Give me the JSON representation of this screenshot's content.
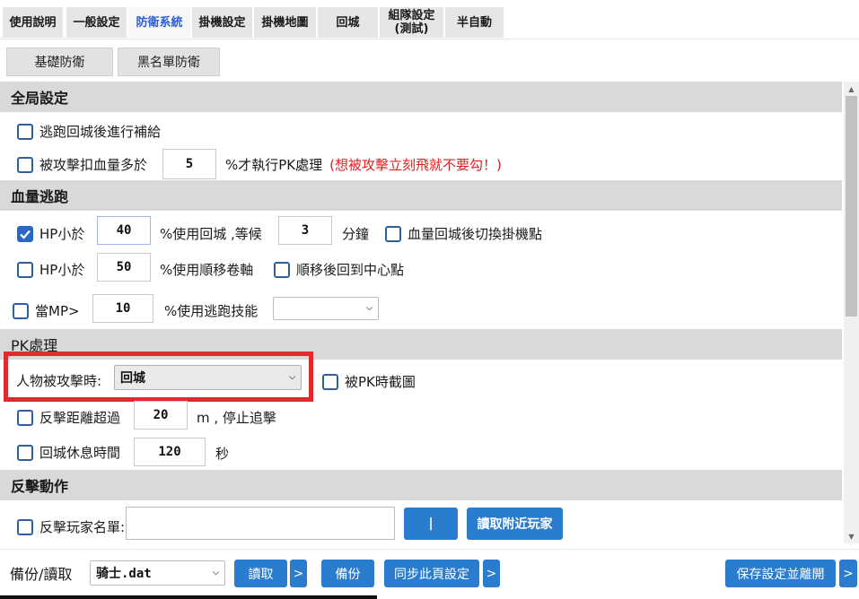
{
  "tabs": [
    {
      "label": "使用說明"
    },
    {
      "label": "一般設定"
    },
    {
      "label": "防衛系統"
    },
    {
      "label": "掛機設定"
    },
    {
      "label": "掛機地圖"
    },
    {
      "label": "回城"
    },
    {
      "label": "組隊設定\n(測試)"
    },
    {
      "label": "半自動"
    }
  ],
  "subtabs": [
    {
      "label": "基礎防衛"
    },
    {
      "label": "黑名單防衛"
    }
  ],
  "sections": {
    "global": "全局設定",
    "hp_escape": "血量逃跑",
    "pk": "PK處理",
    "counter": "反擊動作"
  },
  "global": {
    "escape_refill": {
      "label": "逃跑回城後進行補給",
      "checked": false
    },
    "hp_loss": {
      "label": "被攻擊扣血量多於",
      "checked": false,
      "value": "5",
      "suffix": "%才執行PK處理",
      "warning": "(想被攻擊立刻飛就不要勾！)"
    }
  },
  "hp_escape": {
    "hp1": {
      "label": "HP小於",
      "checked": true,
      "value": "40",
      "mid": "%使用回城 ,等候",
      "wait": "3",
      "unit": "分鐘"
    },
    "switch_point": {
      "label": "血量回城後切換掛機點",
      "checked": false
    },
    "hp2": {
      "label": "HP小於",
      "checked": false,
      "value": "50",
      "mid": "%使用順移卷軸"
    },
    "back_center": {
      "label": "順移後回到中心點",
      "checked": false
    },
    "mp": {
      "label": "當MP>",
      "checked": false,
      "value": "10",
      "mid": "%使用逃跑技能",
      "skill": ""
    }
  },
  "pk": {
    "attacked_label": "人物被攻擊時:",
    "attacked_value": "回城",
    "screenshot": {
      "label": "被PK時截圖",
      "checked": false
    },
    "distance": {
      "label": "反擊距離超過",
      "checked": false,
      "value": "20",
      "suffix": "m , 停止追擊"
    },
    "rest": {
      "label": "回城休息時間",
      "checked": false,
      "value": "120",
      "suffix": "秒"
    }
  },
  "counter": {
    "list": {
      "label": "反擊玩家名單:",
      "checked": false,
      "value": ""
    },
    "separator_button": "|",
    "read_nearby": "讀取附近玩家"
  },
  "bottom": {
    "label": "備份/讀取",
    "file": "骑士.dat",
    "read": "讀取",
    "more": ">",
    "backup": "備份",
    "sync": "同步此頁設定",
    "save_exit": "保存設定並離開"
  },
  "colors": {
    "accent": "#2a7ccf",
    "active_tab_text": "#2b5ed6",
    "warning": "#e0201f",
    "highlight_box": "#e2292d"
  }
}
